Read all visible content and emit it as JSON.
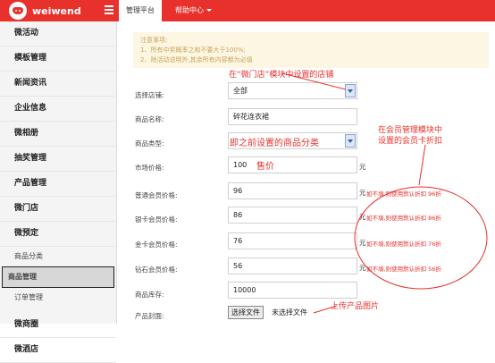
{
  "header": {
    "logo_text": "weiwend",
    "nav": [
      "管理平台",
      "帮助中心"
    ]
  },
  "sidebar": {
    "items": [
      {
        "label": "微活动",
        "type": "main"
      },
      {
        "label": "模板管理",
        "type": "main"
      },
      {
        "label": "新闻资讯",
        "type": "main"
      },
      {
        "label": "企业信息",
        "type": "main"
      },
      {
        "label": "微相册",
        "type": "main"
      },
      {
        "label": "抽奖管理",
        "type": "main"
      },
      {
        "label": "产品管理",
        "type": "main"
      },
      {
        "label": "微门店",
        "type": "main"
      },
      {
        "label": "微预定",
        "type": "main"
      },
      {
        "label": "商品分类",
        "type": "sub"
      },
      {
        "label": "商品管理",
        "type": "sub-active"
      },
      {
        "label": "订单管理",
        "type": "sub"
      },
      {
        "label": "微商圈",
        "type": "main"
      },
      {
        "label": "微酒店",
        "type": "main"
      }
    ]
  },
  "notice": {
    "title": "注意事项:",
    "line1": "1、所有中奖概率之和不要大于100%;",
    "line2": "2、除活动说明外,其余所有内容都为必填"
  },
  "form": {
    "store_label": "选择店铺:",
    "store_value": "全部",
    "name_label": "商品名称:",
    "name_value": "碎花连衣裙",
    "type_label": "商品类型:",
    "market_label": "市场价格:",
    "market_value": "100",
    "market_unit": "元",
    "normal_label": "普通会员价格:",
    "normal_value": "96",
    "silver_label": "银卡会员价格:",
    "silver_value": "86",
    "gold_label": "金卡会员价格:",
    "gold_value": "76",
    "diamond_label": "钻石会员价格:",
    "diamond_value": "56",
    "stock_label": "商品库存:",
    "stock_value": "10000",
    "cover_label": "产品封面:",
    "file_button": "选择文件",
    "file_status": "未选择文件",
    "unit": "元"
  },
  "annotations": {
    "store_note": "在“微门店”模块中设置的店铺",
    "type_note": "即之前设置的商品分类",
    "price_note": "售价",
    "member_note_1": "在会员管理模块中",
    "member_note_2": "设置的会员卡折扣",
    "normal_hint": "如不填,则使用默认折扣 96折",
    "silver_hint": "如不填,则使用默认折扣 86折",
    "gold_hint": "如不填,则使用默认折扣 76折",
    "diamond_hint": "如不填,则使用默认折扣 56折",
    "upload_note": "上传产品图片"
  },
  "colors": {
    "brand_red": "#e8312c",
    "annotation_red": "#e8312c",
    "notice_bg": "#fdf6e3"
  }
}
